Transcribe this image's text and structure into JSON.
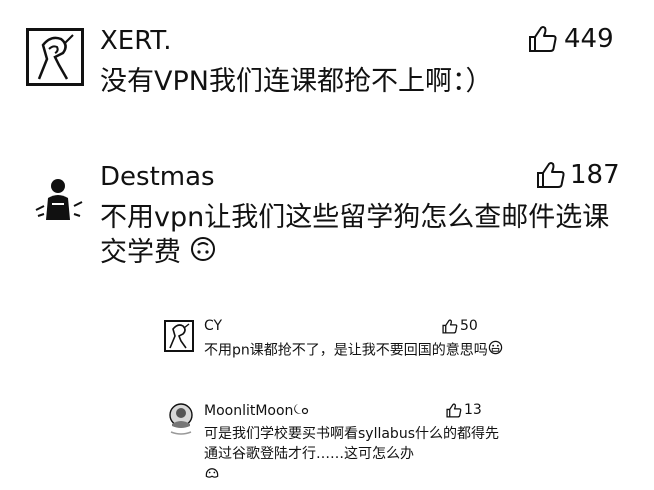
{
  "comments": [
    {
      "username": "XERT.",
      "likes": "449",
      "text": "没有VPN我们连课都抢不上啊：）",
      "avatar_icon": "line-art-figure-avatar"
    },
    {
      "username": "Destmas",
      "likes": "187",
      "text": "不用vpn让我们这些留学狗怎么查邮件选课交学费",
      "trailing_emoji": "upside-down-face-emoji",
      "avatar_icon": "sketch-figure-avatar"
    }
  ],
  "replies": [
    {
      "username": "CY",
      "likes": "50",
      "text": "不用pn课都抢不了，是让我不要回国的意思吗",
      "trailing_emoji": "grimace-face-emoji",
      "avatar_icon": "line-art-figure-avatar"
    },
    {
      "username": "MoonlitMoon",
      "username_emoji": "moon-flower-emoji",
      "likes": "13",
      "text": "可是我们学校要买书啊看syllabus什么的都得先通过谷歌登陆才行……这可怎么办",
      "trailing_emoji": "melting-face-emoji",
      "avatar_icon": "photo-avatar"
    }
  ],
  "icons": {
    "like": "thumbs-up-icon"
  },
  "colors": {
    "text": "#111111",
    "background": "#ffffff"
  }
}
